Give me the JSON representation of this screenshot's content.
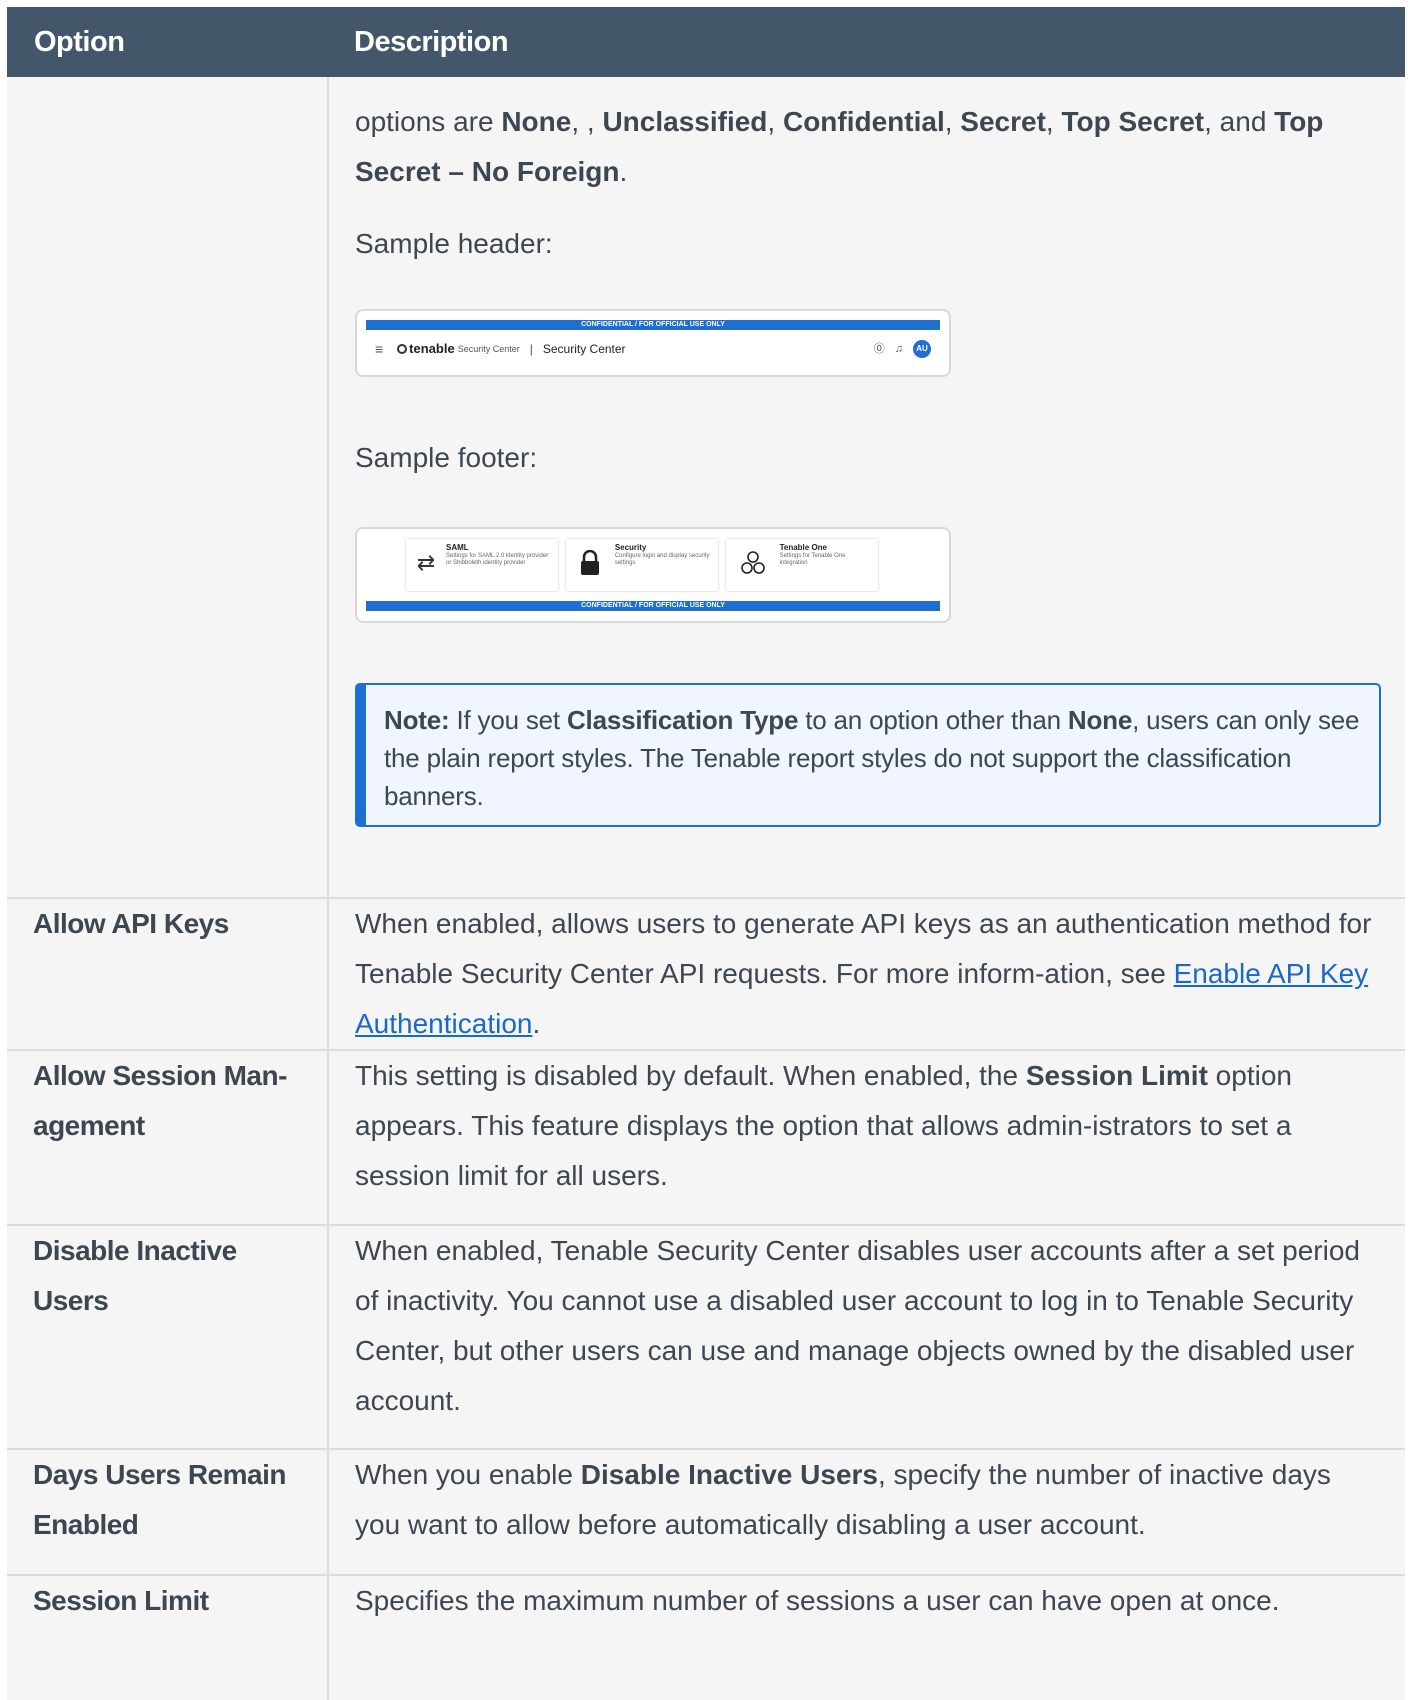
{
  "table": {
    "headers": {
      "option": "Option",
      "description": "Description"
    },
    "classification": {
      "intro_prefix": "options are ",
      "opt_none": "None",
      "sep1": ", , ",
      "opt_unclassified": "Unclassified",
      "sep2": ", ",
      "opt_confidential": "Confidential",
      "sep3": ", ",
      "opt_secret": "Secret",
      "sep4": ", ",
      "opt_top_secret": "Top Secret",
      "sep5": ", and ",
      "opt_top_secret_nf": "Top Secret – No Foreign",
      "end": ".",
      "sample_header_label": "Sample header:",
      "sample_footer_label": "Sample footer:",
      "note": {
        "label": "Note:",
        "t1": " If you set ",
        "b1": "Classification Type",
        "t2": " to an option other than ",
        "b2": "None",
        "t3": ", users can only see the plain report styles. The Tenable report styles do not support the classification banners."
      }
    },
    "sample_header": {
      "banner": "CONFIDENTIAL / FOR OFFICIAL USE ONLY",
      "logo": "tenable",
      "logo_sub": "Security Center",
      "separator": "|",
      "title": "Security Center",
      "avatar": "AU"
    },
    "sample_footer": {
      "banner": "CONFIDENTIAL / FOR OFFICIAL USE ONLY",
      "cards": [
        {
          "title": "SAML",
          "sub": "Settings for SAML 2.0 identity provider or Shibboleth identity provider",
          "icon": "arrows-icon"
        },
        {
          "title": "Security",
          "sub": "Configure login and display security settings",
          "icon": "lock-icon"
        },
        {
          "title": "Tenable One",
          "sub": "Settings for Tenable One integration",
          "icon": "tenable-one-icon"
        }
      ]
    },
    "rows": {
      "api_keys": {
        "option": "Allow API Keys",
        "desc": "When enabled, allows users to generate API keys as an authentication method for Tenable Security Center API requests. For more inform-ation, see ",
        "link": "Enable API Key Authentication",
        "end": "."
      },
      "session_mgmt": {
        "option": "Allow Session Man-agement",
        "d1": "This setting is disabled by default. When enabled, the ",
        "b1": "Session Limit",
        "d2": " option appears. This feature displays the option that allows admin-istrators to set a session limit for all users."
      },
      "disable_inactive": {
        "option": "Disable Inactive Users",
        "desc": "When enabled, Tenable Security Center disables user accounts after a set period of inactivity. You cannot use a disabled user account to log in to Tenable Security Center, but other users can use and manage objects owned by the disabled user account."
      },
      "days_remain": {
        "option": "Days Users Remain Enabled",
        "d1": "When you enable ",
        "b1": "Disable Inactive Users",
        "d2": ", specify the number of inactive days you want to allow before automatically disabling a user account."
      },
      "session_limit": {
        "option": "Session Limit",
        "desc": "Specifies the maximum number of sessions a user can have open at once."
      }
    }
  }
}
